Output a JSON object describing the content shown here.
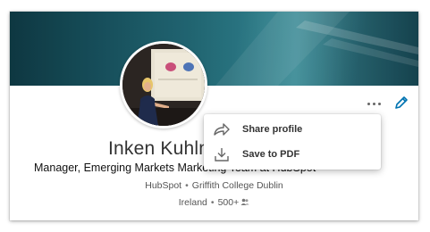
{
  "profile": {
    "name": "Inken Kuhlmann",
    "headline": "Manager, Emerging Markets Marketing Team at HubSpot",
    "company": "HubSpot",
    "school": "Griffith College Dublin",
    "location": "Ireland",
    "connections": "500+",
    "separator": "•"
  },
  "actions": {
    "more_icon": "more-horizontal-icon",
    "edit_icon": "pencil-icon"
  },
  "menu": {
    "items": [
      {
        "label": "Share profile",
        "icon": "share-arrow-icon"
      },
      {
        "label": "Save to PDF",
        "icon": "download-icon"
      }
    ]
  },
  "colors": {
    "accent": "#0073b1",
    "banner": "#1f5f6b"
  }
}
